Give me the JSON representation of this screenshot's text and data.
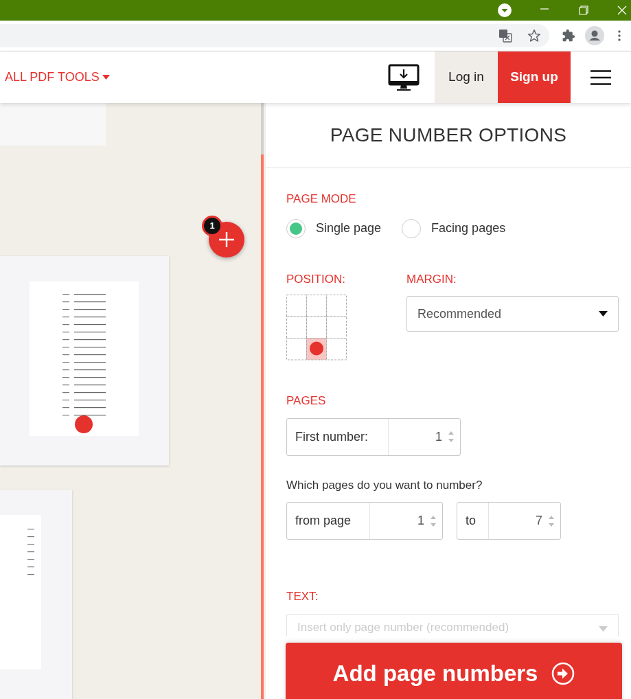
{
  "header": {
    "tools_menu": "ALL PDF TOOLS",
    "login": "Log in",
    "signup": "Sign up"
  },
  "canvas": {
    "files": [
      {
        "badge": "1"
      }
    ]
  },
  "panel": {
    "title": "PAGE NUMBER OPTIONS",
    "page_mode": {
      "label": "PAGE MODE",
      "options": [
        {
          "label": "Single page",
          "selected": true
        },
        {
          "label": "Facing pages",
          "selected": false
        }
      ]
    },
    "position": {
      "label": "POSITION:",
      "cells": [
        {
          "selected": false
        },
        {
          "selected": false
        },
        {
          "selected": false
        },
        {
          "selected": false
        },
        {
          "selected": false
        },
        {
          "selected": false
        },
        {
          "selected": false
        },
        {
          "selected": true
        },
        {
          "selected": false
        }
      ]
    },
    "margin": {
      "label": "MARGIN:",
      "value": "Recommended"
    },
    "pages": {
      "label": "PAGES",
      "first_number": {
        "label": "First number:",
        "value": "1"
      },
      "question": "Which pages do you want to number?",
      "from": {
        "label": "from page",
        "value": "1"
      },
      "to": {
        "label": "to",
        "value": "7"
      }
    },
    "text": {
      "label": "TEXT:",
      "placeholder": "Insert only page number (recommended)"
    },
    "action": "Add page numbers"
  }
}
